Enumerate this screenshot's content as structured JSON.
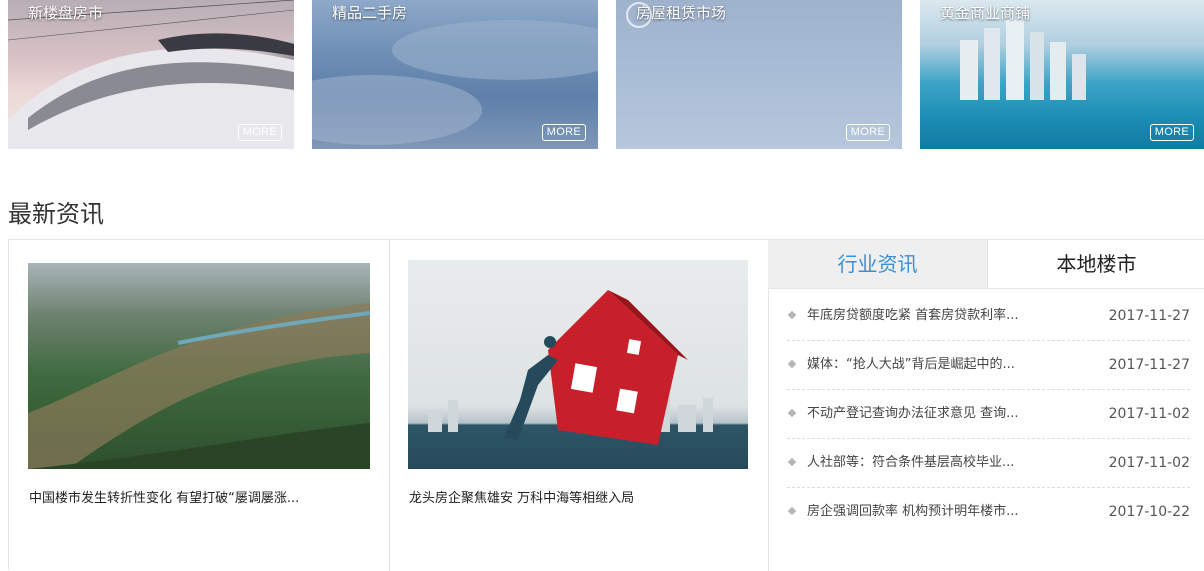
{
  "banners": [
    {
      "title": "新楼盘房市",
      "more": "MORE"
    },
    {
      "title": "精品二手房",
      "more": "MORE"
    },
    {
      "title": "房屋租赁市场",
      "more": "MORE"
    },
    {
      "title": "黄金商业商铺",
      "more": "MORE"
    }
  ],
  "section": {
    "title": "最新资讯"
  },
  "featured": [
    {
      "caption": "中国楼市发生转折性变化 有望打破“屡调屡涨..."
    },
    {
      "caption": "龙头房企聚焦雄安 万科中海等相继入局"
    }
  ],
  "tabs": [
    {
      "label": "行业资讯",
      "active": true
    },
    {
      "label": "本地楼市",
      "active": false
    }
  ],
  "news": [
    {
      "headline": "年底房贷额度吃紧 首套房贷款利率...",
      "date": "2017-11-27"
    },
    {
      "headline": "媒体：“抢人大战”背后是崛起中的...",
      "date": "2017-11-27"
    },
    {
      "headline": "不动产登记查询办法征求意见 查询...",
      "date": "2017-11-02"
    },
    {
      "headline": "人社部等：符合条件基层高校毕业...",
      "date": "2017-11-02"
    },
    {
      "headline": "房企强调回款率 机构预计明年楼市...",
      "date": "2017-10-22"
    }
  ],
  "colors": {
    "accent": "#3a8fd6",
    "active_tab_bg": "#efefef",
    "house_red": "#c8202a"
  }
}
